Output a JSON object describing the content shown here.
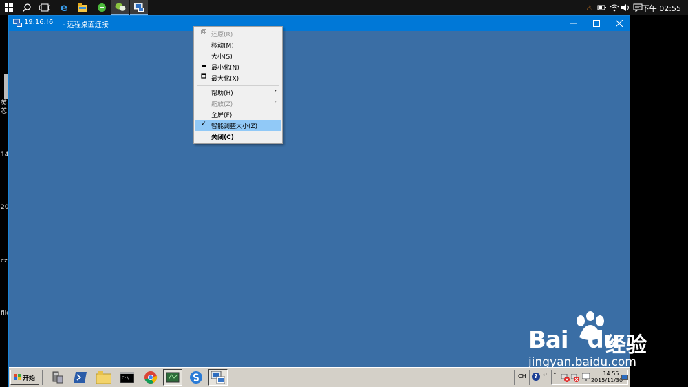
{
  "host_taskbar": {
    "clock": "下午 02:55",
    "icons": [
      "windows-start-icon",
      "search-icon",
      "task-view-icon",
      "edge-icon",
      "file-explorer-icon",
      "green-app-icon",
      "wechat-icon",
      "remote-desktop-icon"
    ],
    "tray_icons": [
      "flame-icon",
      "battery-icon",
      "wifi-icon",
      "volume-icon",
      "notification-icon"
    ]
  },
  "desktop_labels": [
    "英",
    "芯",
    "14",
    "20",
    "cz",
    "file"
  ],
  "rdp_window": {
    "host": "19.16.!6",
    "title": "- 远程桌面连接",
    "background_color": "#3a6ea5"
  },
  "system_menu": {
    "items": [
      {
        "label": "还原(R)",
        "disabled": true,
        "marker": "restore"
      },
      {
        "label": "移动(M)",
        "disabled": false
      },
      {
        "label": "大小(S)",
        "disabled": false
      },
      {
        "label": "最小化(N)",
        "disabled": false,
        "marker": "minimize"
      },
      {
        "label": "最大化(X)",
        "disabled": false,
        "marker": "maximize"
      },
      {
        "label": "帮助(H)",
        "disabled": false,
        "submenu": true
      },
      {
        "label": "缩放(Z)",
        "disabled": true,
        "submenu": true
      },
      {
        "label": "全屏(F)",
        "disabled": false
      },
      {
        "label": "智能调整大小(Z)",
        "disabled": false,
        "checked": true,
        "highlighted": true
      },
      {
        "label": "关闭(C)",
        "disabled": false,
        "bold": true
      }
    ]
  },
  "remote_taskbar": {
    "start_label": "开始",
    "quick_launch": [
      "server-manager-icon",
      "powershell-icon",
      "folder-icon",
      "cmd-icon",
      "chrome-icon",
      "green-window-icon",
      "sogou-icon",
      "remote-desktop-icon"
    ],
    "language": "CH",
    "time": "14:55",
    "date": "2015/11/30"
  },
  "watermark": {
    "logo_a": "Bai",
    "logo_b": "du",
    "logo_cn": "经验",
    "url": "jingyan.baidu.com"
  }
}
